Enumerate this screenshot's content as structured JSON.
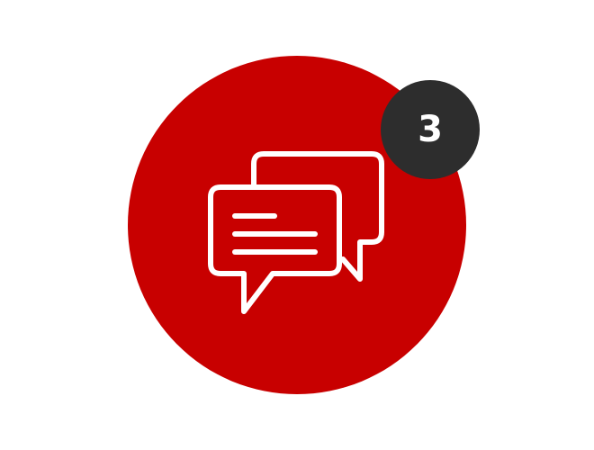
{
  "notification": {
    "icon": "chat-bubbles-icon",
    "count": "3",
    "colors": {
      "circle": "#c80000",
      "badge": "#2d2d2d",
      "badge_text": "#ffffff",
      "icon_stroke": "#ffffff"
    }
  }
}
